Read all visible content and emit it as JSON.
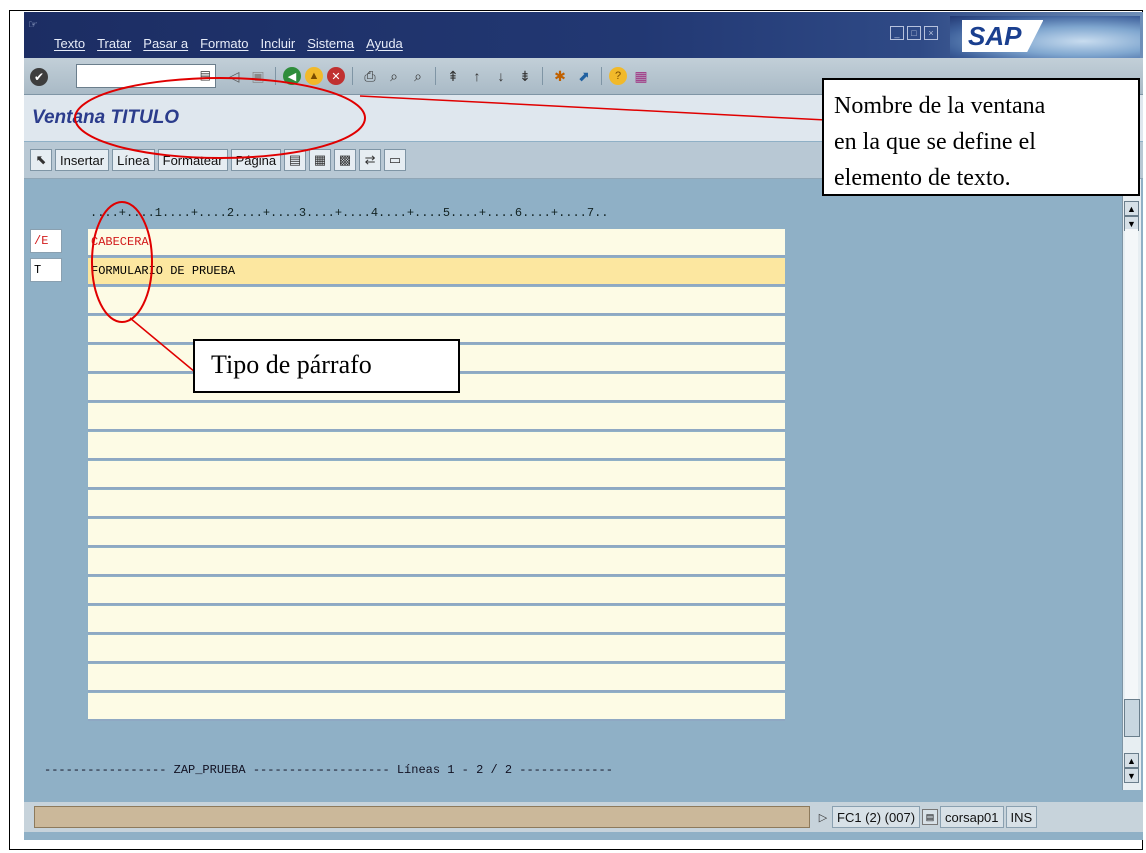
{
  "menubar": {
    "items": [
      "Texto",
      "Tratar",
      "Pasar a",
      "Formato",
      "Incluir",
      "Sistema",
      "Ayuda"
    ],
    "logo": "SAP"
  },
  "toolbar": {
    "icons": [
      "enter-icon",
      "command-field",
      "back-icon",
      "save-icon",
      "back-arrow-icon",
      "exit-icon",
      "cancel-icon",
      "print-icon",
      "find-icon",
      "find-next-icon",
      "first-page-icon",
      "prev-page-icon",
      "next-page-icon",
      "last-page-icon",
      "new-session-icon",
      "shortcut-icon",
      "help-icon",
      "layout-icon"
    ]
  },
  "title": "Ventana TITULO",
  "app_toolbar": {
    "buttons": [
      "Insertar",
      "Línea",
      "Formatear",
      "Página"
    ]
  },
  "editor": {
    "ruler": "....+....1....+....2....+....3....+....4....+....5....+....6....+....7..",
    "rows": [
      {
        "para": "/E",
        "text": "CABECERA",
        "red": true,
        "selected": false
      },
      {
        "para": "T",
        "text": "FORMULARIO DE PRUEBA",
        "red": false,
        "selected": true
      }
    ],
    "empty_lines": 15,
    "footer": "----------------- ZAP_PRUEBA ------------------- Líneas 1 - 2 / 2 -------------"
  },
  "statusbar": {
    "session": "FC1 (2) (007)",
    "server": "corsap01",
    "mode": "INS"
  },
  "annotations": {
    "window_callout": "Nombre de la ventana en la que se define el elemento de texto.",
    "window_callout_lines": [
      "Nombre de la ventana",
      "en la que se define el",
      "elemento de texto."
    ],
    "paragraph_callout": "Tipo de párrafo"
  },
  "colors": {
    "menubar": "#1c2d63",
    "background": "#8fb0c6",
    "title": "#2b3c8c",
    "line": "#fdfbe5",
    "selected_line": "#fce7a0",
    "annotation": "#e00000"
  }
}
